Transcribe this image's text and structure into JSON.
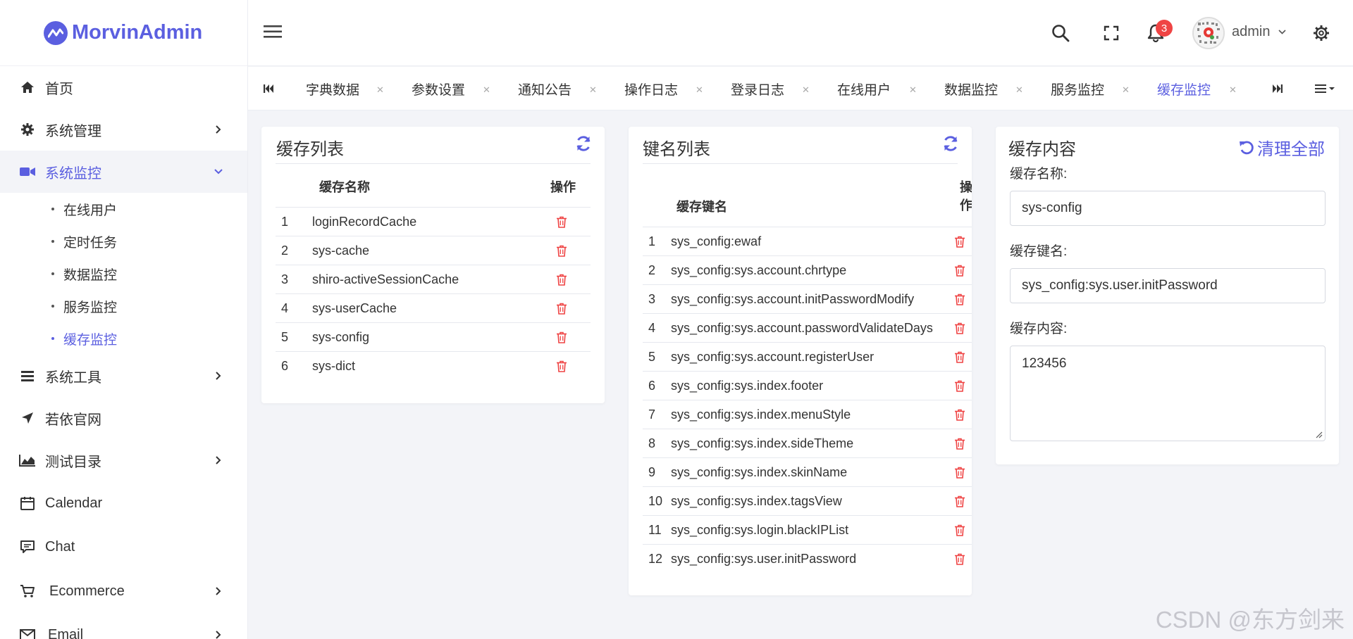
{
  "app": {
    "name": "MorvinAdmin"
  },
  "sidebar": {
    "items": [
      {
        "label": "首页",
        "icon": "home-icon"
      },
      {
        "label": "系统管理",
        "icon": "gear-icon"
      },
      {
        "label": "系统监控",
        "icon": "video-icon"
      },
      {
        "label": "系统工具",
        "icon": "bars-icon"
      },
      {
        "label": "若依官网",
        "icon": "send-icon"
      },
      {
        "label": "测试目录",
        "icon": "area-chart-icon"
      },
      {
        "label": "Calendar",
        "icon": "calendar-icon"
      },
      {
        "label": "Chat",
        "icon": "chat-icon"
      },
      {
        "label": "Ecommerce",
        "icon": "cart-icon"
      },
      {
        "label": "Email",
        "icon": "mail-icon"
      }
    ],
    "monitor_children": [
      "在线用户",
      "定时任务",
      "数据监控",
      "服务监控",
      "缓存监控"
    ]
  },
  "header": {
    "notifications": "3",
    "username": "admin"
  },
  "tabs": [
    "字典数据",
    "参数设置",
    "通知公告",
    "操作日志",
    "登录日志",
    "在线用户",
    "数据监控",
    "服务监控",
    "缓存监控"
  ],
  "cache_list": {
    "title": "缓存列表",
    "col_name": "缓存名称",
    "col_action": "操作",
    "rows": [
      "loginRecordCache",
      "sys-cache",
      "shiro-activeSessionCache",
      "sys-userCache",
      "sys-config",
      "sys-dict"
    ]
  },
  "key_list": {
    "title": "键名列表",
    "col_name": "缓存键名",
    "col_action_1": "操",
    "col_action_2": "作",
    "rows": [
      "sys_config:ewaf",
      "sys_config:sys.account.chrtype",
      "sys_config:sys.account.initPasswordModify",
      "sys_config:sys.account.passwordValidateDays",
      "sys_config:sys.account.registerUser",
      "sys_config:sys.index.footer",
      "sys_config:sys.index.menuStyle",
      "sys_config:sys.index.sideTheme",
      "sys_config:sys.index.skinName",
      "sys_config:sys.index.tagsView",
      "sys_config:sys.login.blackIPList",
      "sys_config:sys.user.initPassword"
    ]
  },
  "cache_content": {
    "title": "缓存内容",
    "clear_label": "清理全部",
    "name_label": "缓存名称:",
    "name_value": "sys-config",
    "key_label": "缓存键名:",
    "key_value": "sys_config:sys.user.initPassword",
    "content_label": "缓存内容:",
    "content_value": "123456"
  },
  "watermark": "CSDN @东方剑来",
  "colors": {
    "accent": "#5b5fe0",
    "danger": "#ef4444",
    "background": "#f3f4f8"
  }
}
